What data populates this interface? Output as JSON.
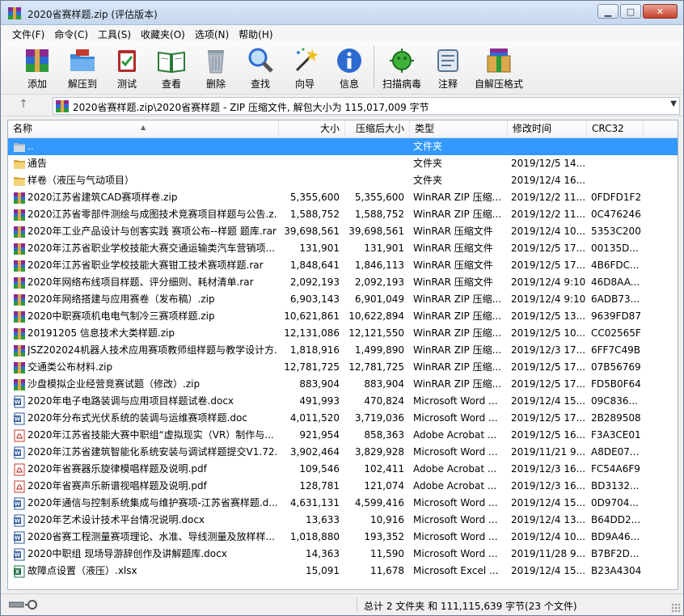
{
  "window": {
    "title": "2020省赛样题.zip (评估版本)"
  },
  "menu": [
    {
      "label": "文件(F)"
    },
    {
      "label": "命令(C)"
    },
    {
      "label": "工具(S)"
    },
    {
      "label": "收藏夹(O)"
    },
    {
      "label": "选项(N)"
    },
    {
      "label": "帮助(H)"
    }
  ],
  "toolbar": [
    {
      "label": "添加",
      "icon": "add-archive-icon"
    },
    {
      "label": "解压到",
      "icon": "extract-folder-icon"
    },
    {
      "label": "测试",
      "icon": "test-clipboard-icon"
    },
    {
      "label": "查看",
      "icon": "view-book-icon"
    },
    {
      "label": "删除",
      "icon": "trash-icon"
    },
    {
      "label": "查找",
      "icon": "magnifier-icon"
    },
    {
      "label": "向导",
      "icon": "wizard-wand-icon"
    },
    {
      "label": "信息",
      "icon": "info-icon"
    },
    {
      "label": "扫描病毒",
      "icon": "virus-scan-icon"
    },
    {
      "label": "注释",
      "icon": "comment-icon"
    },
    {
      "label": "自解压格式",
      "icon": "sfx-box-icon"
    }
  ],
  "address": {
    "path": "2020省赛样题.zip\\2020省赛样题 - ZIP 压缩文件, 解包大小为 115,017,009 字节"
  },
  "columns": {
    "name": "名称",
    "size": "大小",
    "packed": "压缩后大小",
    "type": "类型",
    "modified": "修改时间",
    "crc": "CRC32"
  },
  "files": [
    {
      "name": "..",
      "size": "",
      "packed": "",
      "type": "文件夹",
      "modified": "",
      "crc": "",
      "icon": "up-folder-icon",
      "selected": true
    },
    {
      "name": "通告",
      "size": "",
      "packed": "",
      "type": "文件夹",
      "modified": "2019/12/5 14...",
      "crc": "",
      "icon": "folder-icon"
    },
    {
      "name": "样卷（液压与气动项目）",
      "size": "",
      "packed": "",
      "type": "文件夹",
      "modified": "2019/12/4 16...",
      "crc": "",
      "icon": "folder-icon"
    },
    {
      "name": "2020江苏省建筑CAD赛项样卷.zip",
      "size": "5,355,600",
      "packed": "5,355,600",
      "type": "WinRAR ZIP 压缩...",
      "modified": "2019/12/2 11...",
      "crc": "0FDFD1F2",
      "icon": "rar-icon"
    },
    {
      "name": "2020江苏省零部件测绘与成图技术竞赛项目样题与公告.z...",
      "size": "1,588,752",
      "packed": "1,588,752",
      "type": "WinRAR ZIP 压缩...",
      "modified": "2019/12/2 11...",
      "crc": "0C476246",
      "icon": "rar-icon"
    },
    {
      "name": "2020年工业产品设计与创客实践 赛项公布--样题 题库.rar",
      "size": "39,698,561",
      "packed": "39,698,561",
      "type": "WinRAR 压缩文件",
      "modified": "2019/12/4 10...",
      "crc": "5353C200",
      "icon": "rar-icon"
    },
    {
      "name": "2020年江苏省职业学校技能大赛交通运输类汽车营销项...",
      "size": "131,901",
      "packed": "131,901",
      "type": "WinRAR 压缩文件",
      "modified": "2019/12/5 17...",
      "crc": "00135D...",
      "icon": "rar-icon"
    },
    {
      "name": "2020年江苏省职业学校技能大赛钳工技术赛项样题.rar",
      "size": "1,848,641",
      "packed": "1,846,113",
      "type": "WinRAR 压缩文件",
      "modified": "2019/12/5 17...",
      "crc": "4B6FDC...",
      "icon": "rar-icon"
    },
    {
      "name": "2020年网络布线项目样题、评分细则、耗材清单.rar",
      "size": "2,092,193",
      "packed": "2,092,193",
      "type": "WinRAR 压缩文件",
      "modified": "2019/12/4 9:10",
      "crc": "46D8AA...",
      "icon": "rar-icon"
    },
    {
      "name": "2020年网络搭建与应用赛卷（发布稿）.zip",
      "size": "6,903,143",
      "packed": "6,901,049",
      "type": "WinRAR ZIP 压缩...",
      "modified": "2019/12/4 9:10",
      "crc": "6ADB73...",
      "icon": "rar-icon"
    },
    {
      "name": "2020中职赛项机电电气制冷三赛项样题.zip",
      "size": "10,621,861",
      "packed": "10,622,894",
      "type": "WinRAR ZIP 压缩...",
      "modified": "2019/12/5 13...",
      "crc": "9639FD87",
      "icon": "rar-icon"
    },
    {
      "name": "20191205 信息技术大类样题.zip",
      "size": "12,131,086",
      "packed": "12,121,550",
      "type": "WinRAR ZIP 压缩...",
      "modified": "2019/12/5 10...",
      "crc": "CC02565F",
      "icon": "rar-icon"
    },
    {
      "name": "JSZ202024机器人技术应用赛项教师组样题与教学设计方...",
      "size": "1,818,916",
      "packed": "1,499,890",
      "type": "WinRAR ZIP 压缩...",
      "modified": "2019/12/3 17...",
      "crc": "6FF7C49B",
      "icon": "rar-icon"
    },
    {
      "name": "交通类公布材料.zip",
      "size": "12,781,725",
      "packed": "12,781,725",
      "type": "WinRAR ZIP 压缩...",
      "modified": "2019/12/5 17...",
      "crc": "07B56769",
      "icon": "rar-icon"
    },
    {
      "name": "沙盘模拟企业经营竞赛试题（修改）.zip",
      "size": "883,904",
      "packed": "883,904",
      "type": "WinRAR ZIP 压缩...",
      "modified": "2019/12/5 17...",
      "crc": "FD5B0F64",
      "icon": "rar-icon"
    },
    {
      "name": "2020年电子电路装调与应用项目样题试卷.docx",
      "size": "491,993",
      "packed": "470,824",
      "type": "Microsoft Word ...",
      "modified": "2019/12/4 15...",
      "crc": "09C836...",
      "icon": "word-icon"
    },
    {
      "name": "2020年分布式光伏系统的装调与运维赛项样题.doc",
      "size": "4,011,520",
      "packed": "3,719,036",
      "type": "Microsoft Word ...",
      "modified": "2019/12/5 17...",
      "crc": "2B289508",
      "icon": "word-icon"
    },
    {
      "name": "2020年江苏省技能大赛中职组“虚拟现实（VR）制作与...",
      "size": "921,954",
      "packed": "858,363",
      "type": "Adobe Acrobat ...",
      "modified": "2019/12/5 16...",
      "crc": "F3A3CE01",
      "icon": "pdf-icon"
    },
    {
      "name": "2020年江苏省建筑智能化系统安装与调试样题提交V1.72...",
      "size": "3,902,464",
      "packed": "3,829,928",
      "type": "Microsoft Word ...",
      "modified": "2019/11/21 9...",
      "crc": "A8DE07...",
      "icon": "word-icon"
    },
    {
      "name": "2020年省赛器乐旋律模唱样题及说明.pdf",
      "size": "109,546",
      "packed": "102,411",
      "type": "Adobe Acrobat ...",
      "modified": "2019/12/3 16...",
      "crc": "FC54A6F9",
      "icon": "pdf-icon"
    },
    {
      "name": "2020年省赛声乐新谱视唱样题及说明.pdf",
      "size": "128,781",
      "packed": "121,074",
      "type": "Adobe Acrobat ...",
      "modified": "2019/12/3 16...",
      "crc": "BD3132...",
      "icon": "pdf-icon"
    },
    {
      "name": "2020年通信与控制系统集成与维护赛项-江苏省赛样题.d...",
      "size": "4,631,131",
      "packed": "4,599,416",
      "type": "Microsoft Word ...",
      "modified": "2019/12/4 15...",
      "crc": "0D9704...",
      "icon": "word-icon"
    },
    {
      "name": "2020年艺术设计技术平台情况说明.docx",
      "size": "13,633",
      "packed": "10,916",
      "type": "Microsoft Word ...",
      "modified": "2019/12/4 13...",
      "crc": "B64DD2...",
      "icon": "word-icon"
    },
    {
      "name": "2020省赛工程测量赛项理论、水准、导线测量及放样样...",
      "size": "1,018,880",
      "packed": "193,352",
      "type": "Microsoft Word ...",
      "modified": "2019/12/4 10...",
      "crc": "BD9A46...",
      "icon": "word-icon"
    },
    {
      "name": "2020中职组 现场导游辞创作及讲解题库.docx",
      "size": "14,363",
      "packed": "11,590",
      "type": "Microsoft Word ...",
      "modified": "2019/11/28 9...",
      "crc": "B7BF2D...",
      "icon": "word-icon"
    },
    {
      "name": "故障点设置（液压）.xlsx",
      "size": "15,091",
      "packed": "11,678",
      "type": "Microsoft Excel ...",
      "modified": "2019/12/4 15...",
      "crc": "B23A4304",
      "icon": "excel-icon"
    }
  ],
  "status": {
    "text": "总计 2 文件夹 和 111,115,639 字节(23 个文件)"
  }
}
